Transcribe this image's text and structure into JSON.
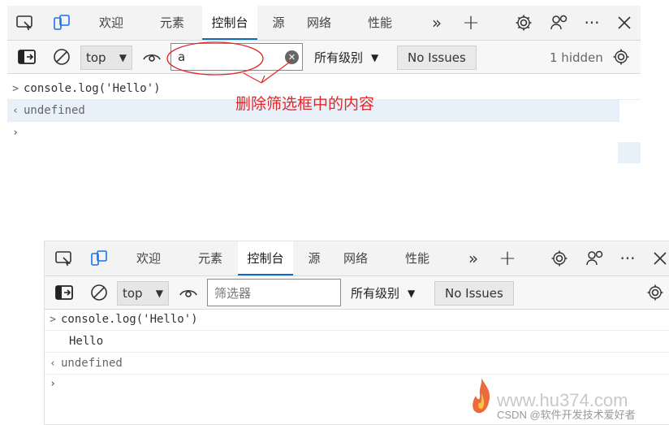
{
  "top_panel": {
    "tabs": [
      "欢迎",
      "元素",
      "控制台",
      "源",
      "网络",
      "性能"
    ],
    "active_tab": "控制台",
    "toolbar": {
      "context": "top",
      "filter_value": "a",
      "levels_label": "所有级别",
      "issues_label": "No Issues",
      "hidden_label": "1 hidden"
    },
    "console": {
      "input_line": "console.log('Hello')",
      "result_line": "undefined"
    },
    "annotation": "删除筛选框中的内容"
  },
  "bottom_panel": {
    "tabs": [
      "欢迎",
      "元素",
      "控制台",
      "源",
      "网络",
      "性能"
    ],
    "active_tab": "控制台",
    "toolbar": {
      "context": "top",
      "filter_placeholder": "筛选器",
      "levels_label": "所有级别",
      "issues_label": "No Issues"
    },
    "console": {
      "input_line": "console.log('Hello')",
      "output_line": "Hello",
      "result_line": "undefined"
    }
  },
  "watermark": {
    "site": "www.hu374.com",
    "csdn": "CSDN @软件开发技术爱好者"
  },
  "colors": {
    "accent": "#0f6cbd",
    "annotation": "#e0282a",
    "prompt": "#1a73e8"
  }
}
